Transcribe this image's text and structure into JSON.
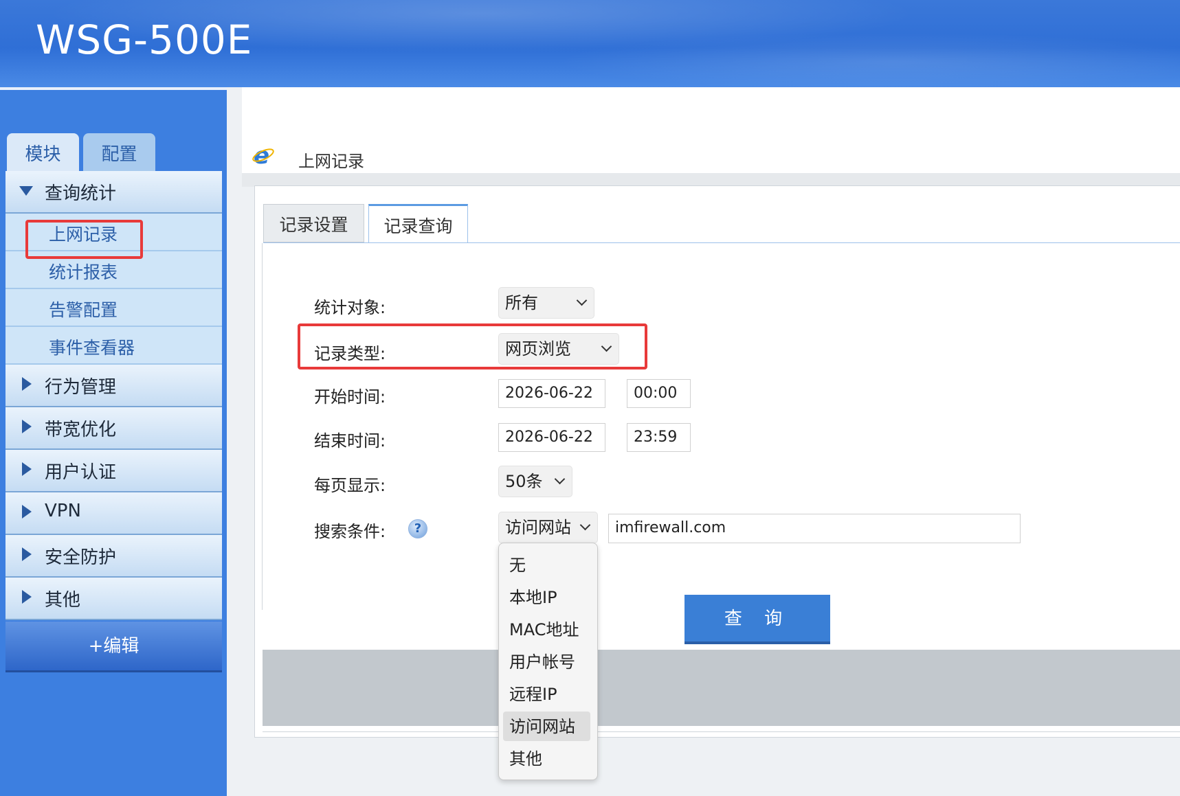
{
  "app": {
    "title": "WSG-500E"
  },
  "sidebar": {
    "tabs": [
      {
        "label": "模块"
      },
      {
        "label": "配置"
      }
    ],
    "groups": [
      {
        "label": "查询统计",
        "expanded": true,
        "items": [
          {
            "label": "上网记录"
          },
          {
            "label": "统计报表"
          },
          {
            "label": "告警配置"
          },
          {
            "label": "事件查看器"
          }
        ]
      },
      {
        "label": "行为管理"
      },
      {
        "label": "带宽优化"
      },
      {
        "label": "用户认证"
      },
      {
        "label": "VPN"
      },
      {
        "label": "安全防护"
      },
      {
        "label": "其他"
      }
    ],
    "edit_label": "+编辑"
  },
  "page": {
    "title": "上网记录",
    "icon": "ie-icon"
  },
  "tabs": [
    {
      "label": "记录设置"
    },
    {
      "label": "记录查询"
    }
  ],
  "form": {
    "target": {
      "label": "统计对象:",
      "value": "所有"
    },
    "record_type": {
      "label": "记录类型:",
      "value": "网页浏览"
    },
    "start": {
      "label": "开始时间:",
      "date": "2026-06-22",
      "time": "00:00"
    },
    "end": {
      "label": "结束时间:",
      "date": "2026-06-22",
      "time": "23:59"
    },
    "per_page": {
      "label": "每页显示:",
      "value": "50条"
    },
    "search": {
      "label": "搜索条件:",
      "field": "访问网站",
      "value": "imfirewall.com",
      "help": "?"
    },
    "submit_label": "查 询"
  },
  "search_dropdown": {
    "options": [
      "无",
      "本地IP",
      "MAC地址",
      "用户帐号",
      "远程IP",
      "访问网站",
      "其他"
    ],
    "selected": "访问网站"
  },
  "colors": {
    "highlight": "#e83a3a",
    "accent": "#3a7fd6",
    "sidebar_bg": "#3d7fe0"
  }
}
